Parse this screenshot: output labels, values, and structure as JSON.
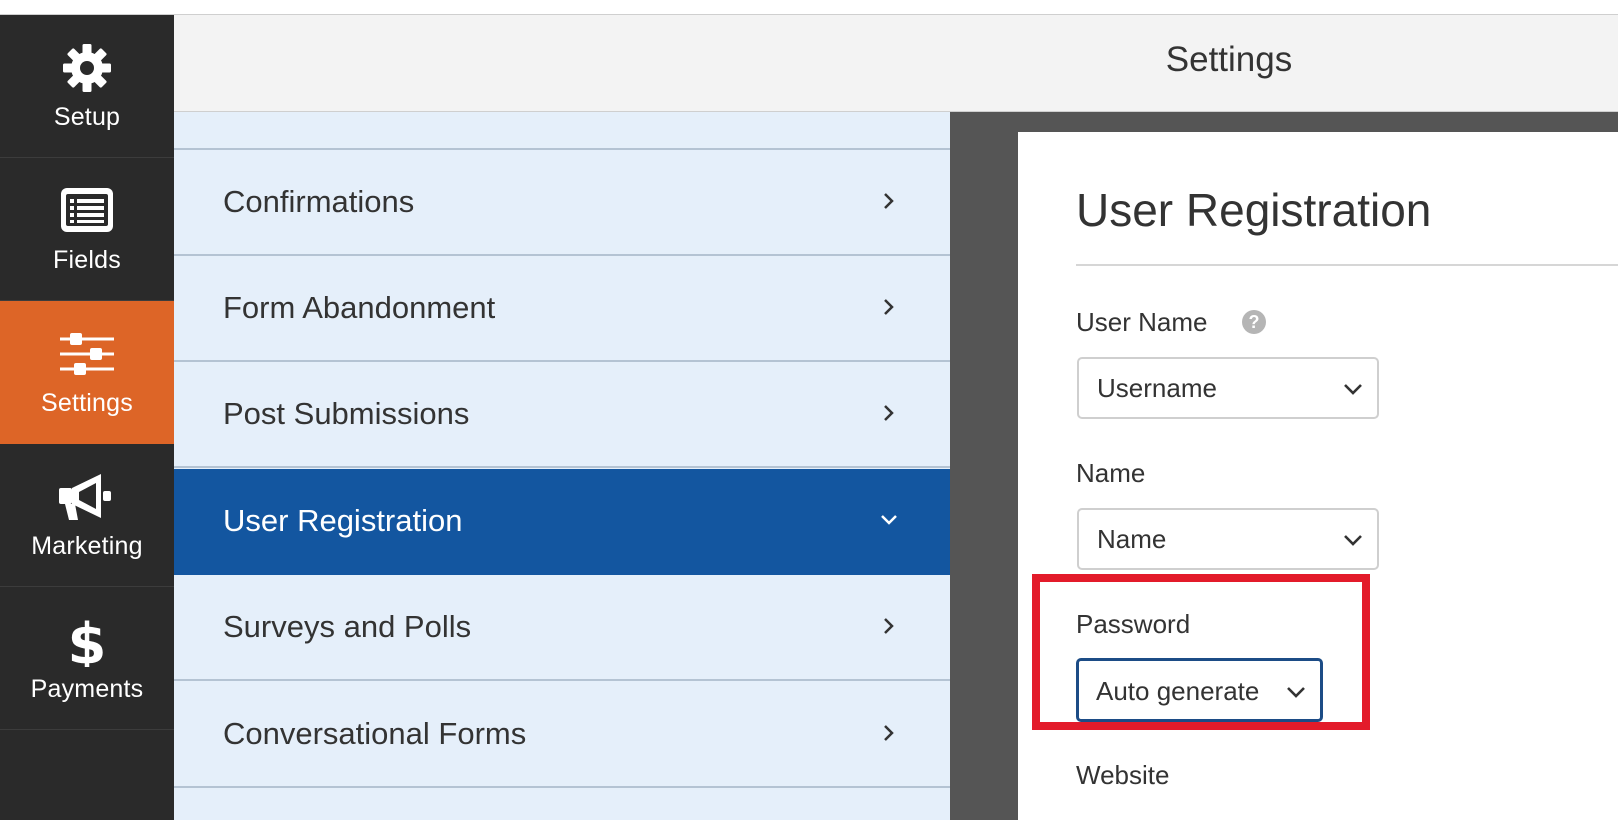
{
  "sidebar": {
    "items": [
      {
        "label": "Setup",
        "icon": "gear-icon"
      },
      {
        "label": "Fields",
        "icon": "list-icon"
      },
      {
        "label": "Settings",
        "icon": "sliders-icon"
      },
      {
        "label": "Marketing",
        "icon": "megaphone-icon"
      },
      {
        "label": "Payments",
        "icon": "dollar-icon"
      }
    ],
    "active_color": "#dd6527"
  },
  "header": {
    "title": "Settings"
  },
  "settings_list": {
    "items": [
      {
        "label": "Confirmations"
      },
      {
        "label": "Form Abandonment"
      },
      {
        "label": "Post Submissions"
      },
      {
        "label": "User Registration"
      },
      {
        "label": "Surveys and Polls"
      },
      {
        "label": "Conversational Forms"
      }
    ],
    "active_color": "#1356a0"
  },
  "panel": {
    "title": "User Registration",
    "fields": [
      {
        "label": "User Name",
        "value": "Username"
      },
      {
        "label": "Name",
        "value": "Name"
      },
      {
        "label": "Password",
        "value": "Auto generate"
      },
      {
        "label": "Website"
      }
    ],
    "help_glyph": "?"
  },
  "highlight_color": "#e31b2a"
}
